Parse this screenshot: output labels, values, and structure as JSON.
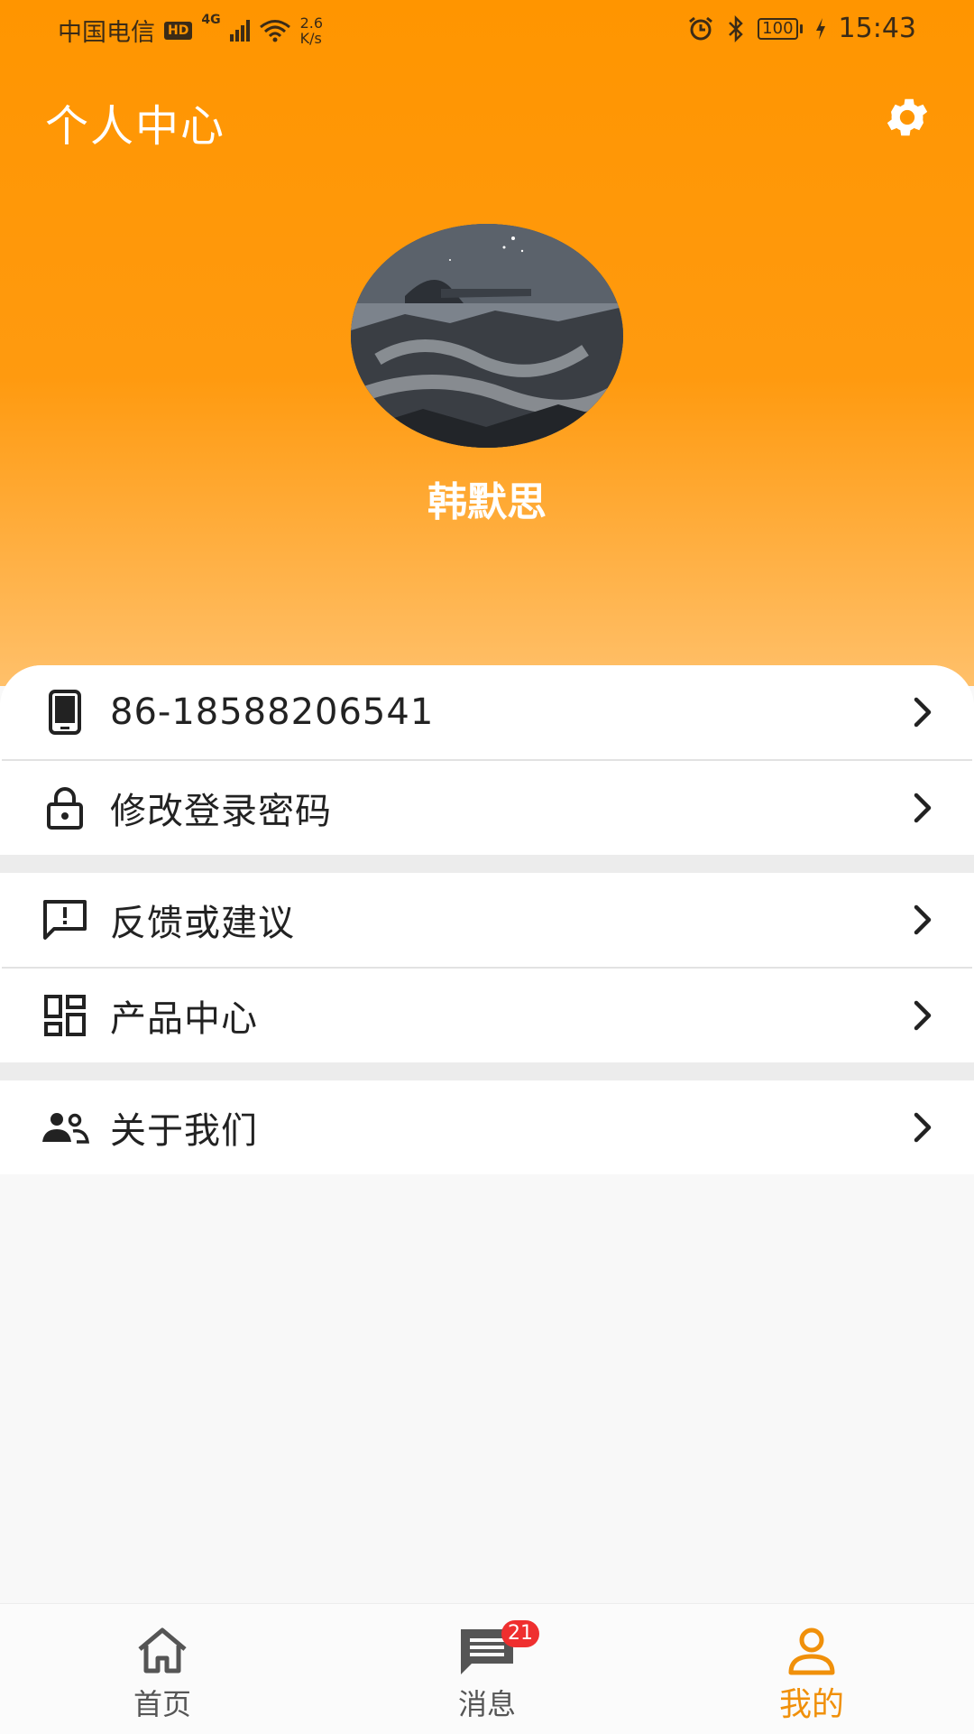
{
  "status_bar": {
    "carrier": "中国电信",
    "hd": "HD",
    "network": "4G",
    "speed_value": "2.6",
    "speed_unit": "K/s",
    "battery": "100",
    "time": "15:43"
  },
  "header": {
    "title": "个人中心",
    "settings_icon": "gear-icon"
  },
  "profile": {
    "name": "韩默思"
  },
  "menu": {
    "items": [
      {
        "label": "86-18588206541",
        "icon": "phone-icon"
      },
      {
        "label": "修改登录密码",
        "icon": "lock-icon"
      },
      {
        "label": "反馈或建议",
        "icon": "feedback-icon"
      },
      {
        "label": "产品中心",
        "icon": "grid-icon"
      },
      {
        "label": "关于我们",
        "icon": "people-icon"
      }
    ]
  },
  "tabbar": {
    "tabs": [
      {
        "label": "首页",
        "icon": "home-icon",
        "active": false
      },
      {
        "label": "消息",
        "icon": "message-icon",
        "active": false,
        "badge": "21"
      },
      {
        "label": "我的",
        "icon": "person-icon",
        "active": true
      }
    ]
  },
  "colors": {
    "accent": "#ff9500",
    "active_tab": "#f0900a",
    "badge": "#ef2f2f"
  }
}
